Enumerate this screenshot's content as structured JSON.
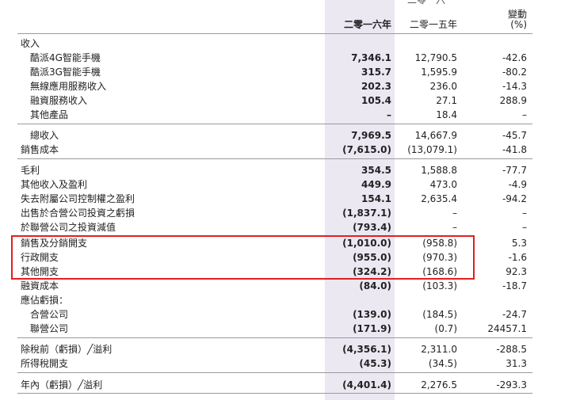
{
  "header": {
    "top_partial": "二零一六",
    "col_2016": "二零一六年",
    "col_2015": "二零一五年",
    "col_change_line1": "變動",
    "col_change_line2": "(%)"
  },
  "rows": [
    {
      "label": "收入",
      "v2016": "",
      "v2015": "",
      "change": ""
    },
    {
      "label": "酷派4G智能手機",
      "v2016": "7,346.1",
      "v2015": "12,790.5",
      "change": "-42.6"
    },
    {
      "label": "酷派3G智能手機",
      "v2016": "315.7",
      "v2015": "1,595.9",
      "change": "-80.2"
    },
    {
      "label": "無線應用服務收入",
      "v2016": "202.3",
      "v2015": "236.0",
      "change": "-14.3"
    },
    {
      "label": "融資服務收入",
      "v2016": "105.4",
      "v2015": "27.1",
      "change": "288.9"
    },
    {
      "label": "其他產品",
      "v2016": "–",
      "v2015": "18.4",
      "change": "–"
    },
    {
      "label": "總收入",
      "v2016": "7,969.5",
      "v2015": "14,667.9",
      "change": "-45.7"
    },
    {
      "label": "銷售成本",
      "v2016": "(7,615.0)",
      "v2015": "(13,079.1)",
      "change": "-41.8"
    },
    {
      "label": "毛利",
      "v2016": "354.5",
      "v2015": "1,588.8",
      "change": "-77.7"
    },
    {
      "label": "其他收入及盈利",
      "v2016": "449.9",
      "v2015": "473.0",
      "change": "-4.9"
    },
    {
      "label": "失去附屬公司控制權之盈利",
      "v2016": "154.1",
      "v2015": "2,635.4",
      "change": "-94.2"
    },
    {
      "label": "出售於合營公司投資之虧損",
      "v2016": "(1,837.1)",
      "v2015": "–",
      "change": "–"
    },
    {
      "label": "於聯營公司之投資減值",
      "v2016": "(793.4)",
      "v2015": "–",
      "change": "–"
    },
    {
      "label": "銷售及分銷開支",
      "v2016": "(1,010.0)",
      "v2015": "(958.8)",
      "change": "5.3"
    },
    {
      "label": "行政開支",
      "v2016": "(955.0)",
      "v2015": "(970.3)",
      "change": "-1.6"
    },
    {
      "label": "其他開支",
      "v2016": "(324.2)",
      "v2015": "(168.6)",
      "change": "92.3"
    },
    {
      "label": "融資成本",
      "v2016": "(84.0)",
      "v2015": "(103.3)",
      "change": "-18.7"
    },
    {
      "label": "應佔虧損：",
      "v2016": "",
      "v2015": "",
      "change": ""
    },
    {
      "label": "合營公司",
      "v2016": "(139.0)",
      "v2015": "(184.5)",
      "change": "-24.7"
    },
    {
      "label": "聯營公司",
      "v2016": "(171.9)",
      "v2015": "(0.7)",
      "change": "24457.1"
    },
    {
      "label": "除稅前（虧損）╱溢利",
      "v2016": "(4,356.1)",
      "v2015": "2,311.0",
      "change": "-288.5"
    },
    {
      "label": "所得稅開支",
      "v2016": "(45.3)",
      "v2015": "(34.5)",
      "change": "31.3"
    },
    {
      "label": "年內（虧損）╱溢利",
      "v2016": "(4,401.4)",
      "v2015": "2,276.5",
      "change": "-293.3"
    }
  ]
}
